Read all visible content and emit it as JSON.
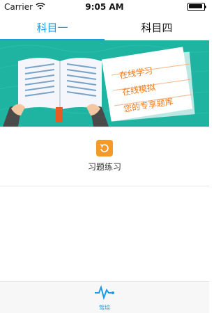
{
  "statusbar": {
    "carrier": "Carrier",
    "time": "9:05 AM"
  },
  "tabs": [
    {
      "label": "科目一",
      "active": true
    },
    {
      "label": "科目四",
      "active": false
    }
  ],
  "banner": {
    "lines": [
      "在线学习",
      "在线模拟",
      "您的专享题库"
    ]
  },
  "menu": {
    "items": [
      {
        "label": "习题练习",
        "icon": "refresh-icon"
      }
    ]
  },
  "bottom_nav": {
    "items": [
      {
        "label": "驾培",
        "icon": "pulse-icon",
        "active": true
      }
    ]
  },
  "colors": {
    "accent": "#1a9be6",
    "banner_bg": "#1fb3a2",
    "orange": "#f39a2b"
  }
}
